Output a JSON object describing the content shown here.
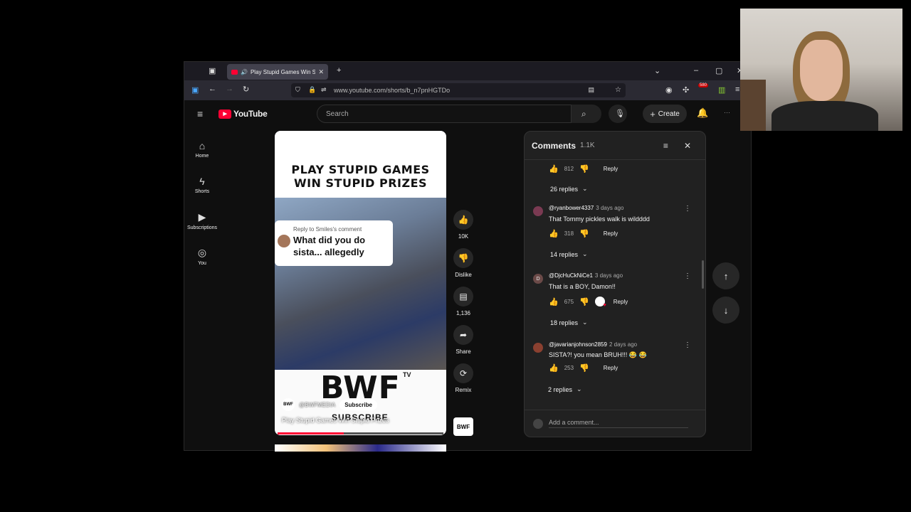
{
  "browser": {
    "tab_title": "Play Stupid Games Win St",
    "url": "www.youtube.com/shorts/b_n7pnHGTDo",
    "badge": "580"
  },
  "header": {
    "logo": "YouTube",
    "search_placeholder": "Search",
    "create_label": "Create"
  },
  "sidebar": {
    "items": [
      {
        "label": "Home",
        "icon": "home-icon"
      },
      {
        "label": "Shorts",
        "icon": "shorts-icon"
      },
      {
        "label": "Subscriptions",
        "icon": "subscriptions-icon"
      },
      {
        "label": "You",
        "icon": "account-icon"
      }
    ]
  },
  "short": {
    "headline_1": "PLAY STUPID GAMES",
    "headline_2": "WIN STUPID PRIZES",
    "reply_to": "Reply to Smiles's comment",
    "reply_text_1": "What did you do",
    "reply_text_2": "sista... allegedly",
    "brand": "BWF",
    "brand_tv": "TV",
    "brand_script": "SUBSCRIBE",
    "channel_avatar": "BWF",
    "channel": "@BWFMEDIA",
    "subscribe": "Subscribe",
    "title": "Play Stupid Games Win Stupid Prizes",
    "progress": 0.4
  },
  "actions": {
    "like_count": "10K",
    "dislike_label": "Dislike",
    "comments_count": "1,136",
    "share_label": "Share",
    "remix_label": "Remix",
    "channel_thumb": "BWF"
  },
  "comments": {
    "title": "Comments",
    "count": "1.1K",
    "top_likes": "812",
    "top_replies": "26 replies",
    "items": [
      {
        "user": "@ryanbower4337",
        "time": "3 days ago",
        "text": "That Tommy pickles walk is wildddd",
        "likes": "318",
        "replies": "14 replies",
        "avatar": ""
      },
      {
        "user": "@DjcHuCkNiCe1",
        "time": "3 days ago",
        "text": "That is a BOY, Damon!!",
        "likes": "675",
        "replies": "18 replies",
        "avatar": "D"
      },
      {
        "user": "@javarianjohnson2859",
        "time": "2 days ago",
        "text": "SISTA?! you mean BRUH!!! 😂 😂",
        "likes": "253",
        "replies": "2 replies",
        "avatar": ""
      }
    ],
    "reply_label": "Reply",
    "add_placeholder": "Add a comment..."
  }
}
